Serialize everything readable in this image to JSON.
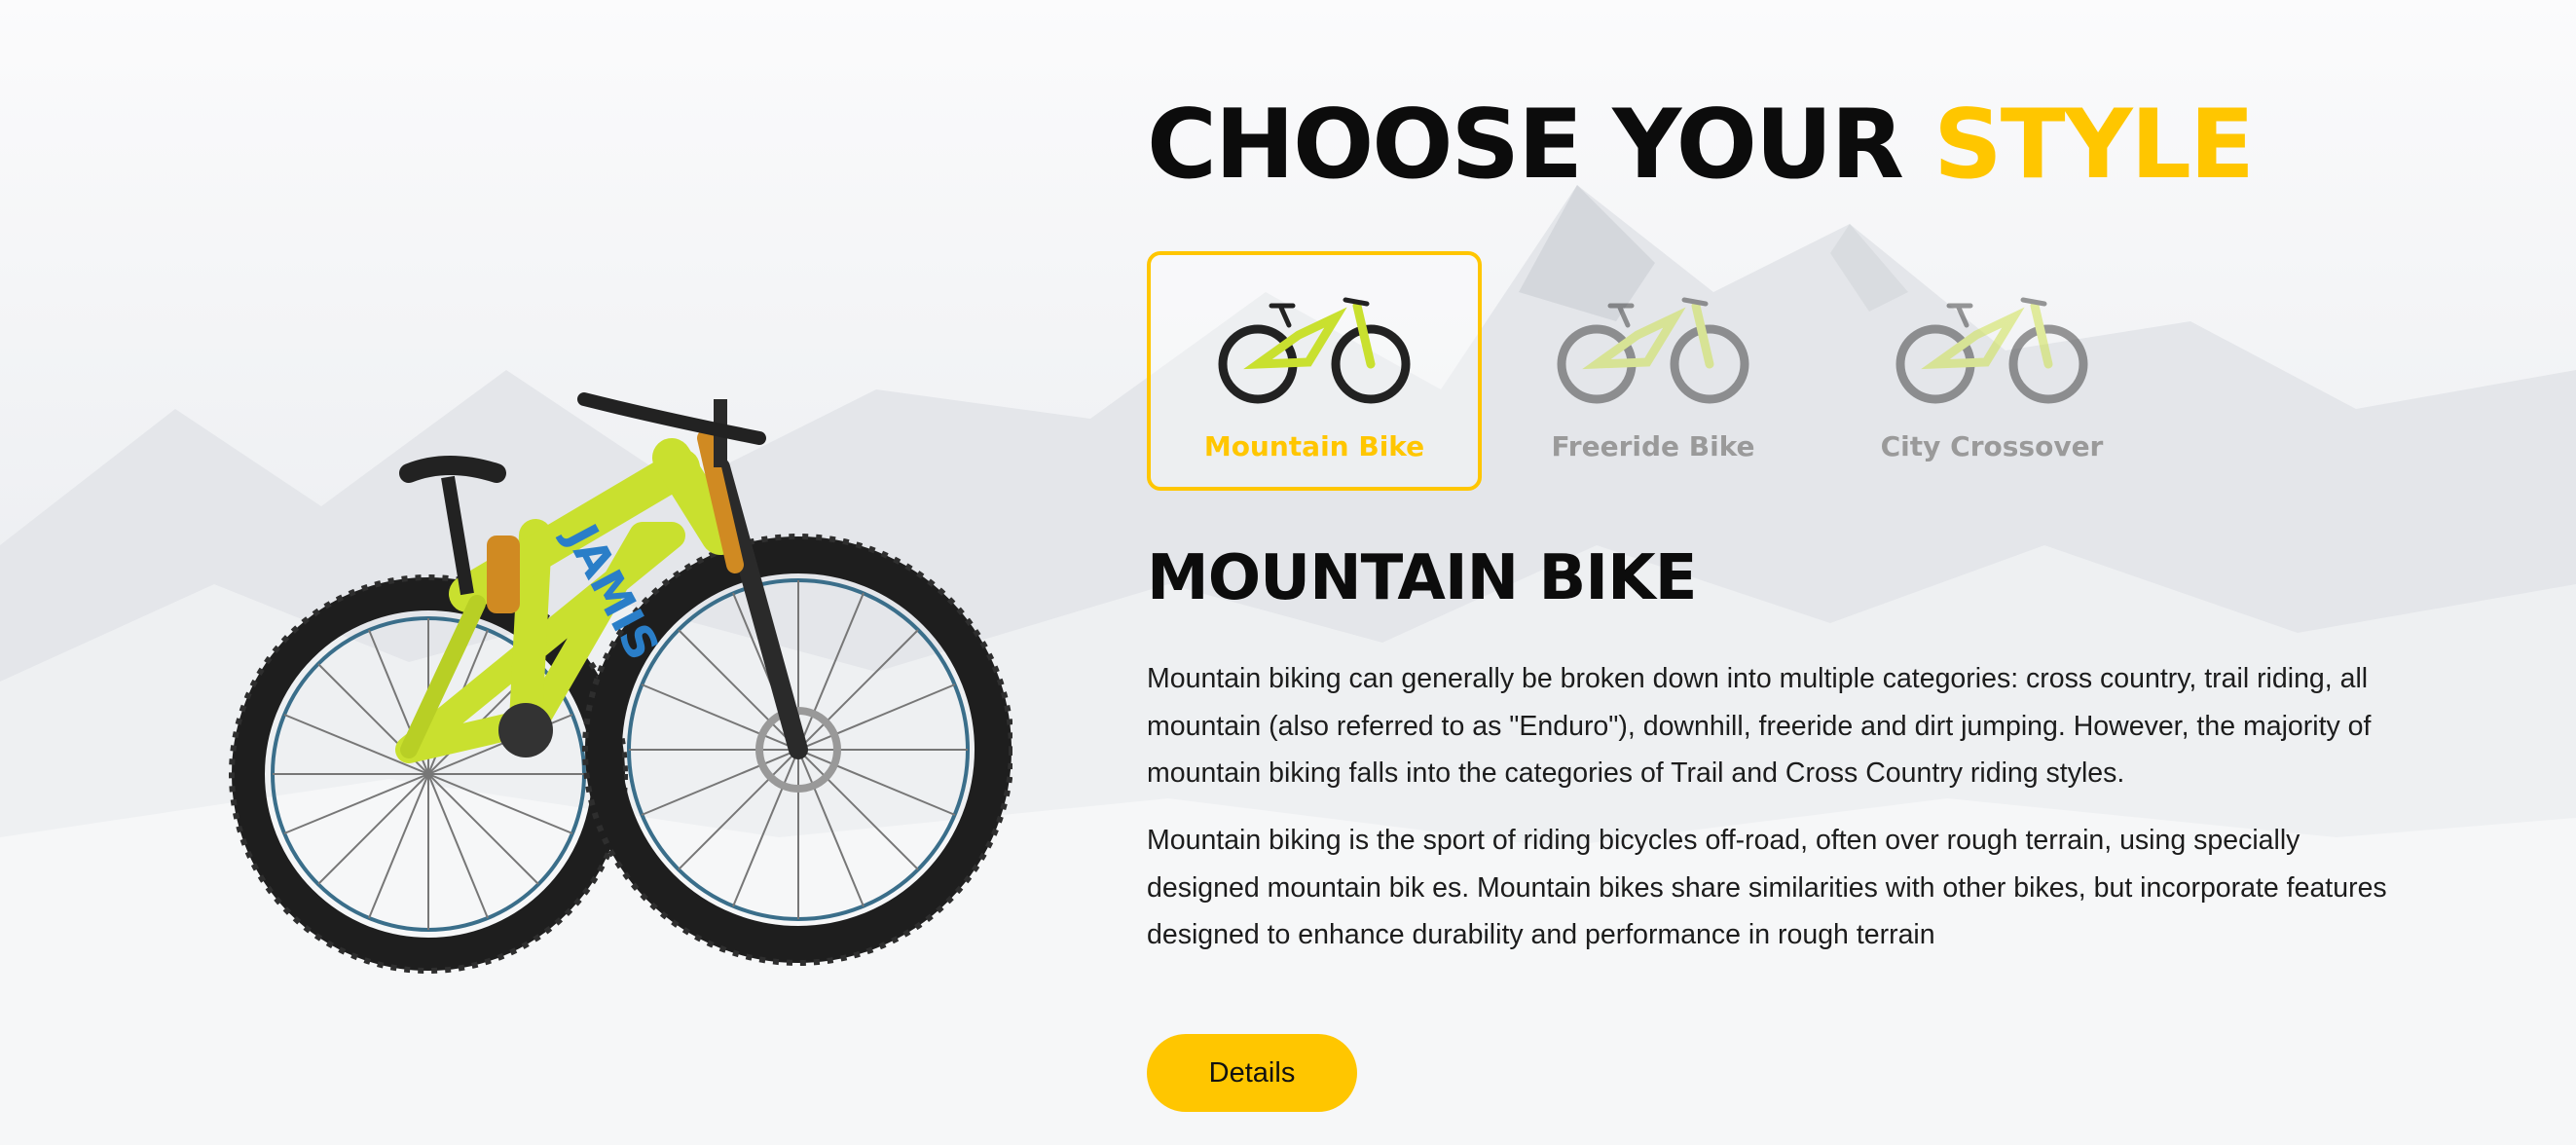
{
  "heading": {
    "prefix": "CHOOSE YOUR",
    "accent": "STYLE"
  },
  "colors": {
    "accent": "#ffc600",
    "text": "#0c0c0c",
    "muted": "#9a9a9a",
    "frame": "#c9e02f"
  },
  "hero_image": {
    "icon": "mountain-bike-photo",
    "frame_text": "JAMIS"
  },
  "styles": [
    {
      "label": "Mountain Bike",
      "selected": true
    },
    {
      "label": "Freeride Bike",
      "selected": false
    },
    {
      "label": "City Crossover",
      "selected": false
    }
  ],
  "detail": {
    "title": "MOUNTAIN BIKE",
    "paragraphs": [
      "Mountain biking can generally be broken down into multiple categories: cross country, trail riding, all mountain (also referred to as \"Enduro\"), downhill, freeride and dirt jumping. However, the majority of mountain biking falls into the categories of Trail and Cross Country riding styles.",
      "Mountain biking is the sport of riding bicycles off-road, often over rough terrain, using specially designed mountain bik es. Mountain bikes share similarities with other bikes, but incorporate features designed to enhance durability and performance in rough terrain"
    ],
    "button_label": "Details"
  }
}
